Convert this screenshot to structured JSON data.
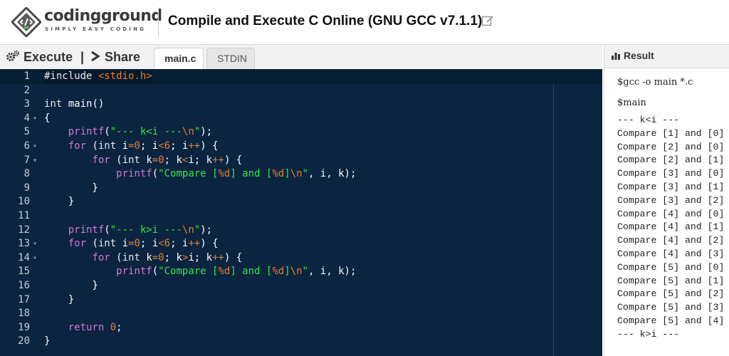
{
  "header": {
    "logo_word": "codingground",
    "logo_tagline": "SIMPLY EASY CODING",
    "title": "Compile and Execute C Online (GNU GCC v7.1.1)"
  },
  "toolbar": {
    "execute_label": "Execute",
    "separator": "|",
    "share_label": "Share",
    "tabs": [
      {
        "label": "main.c",
        "active": true
      },
      {
        "label": "STDIN",
        "active": false
      }
    ]
  },
  "result": {
    "title": "Result",
    "commands": [
      "$gcc -o main *.c",
      "$main"
    ],
    "output": [
      "--- k<i ---",
      "Compare [1] and [0]",
      "Compare [2] and [0]",
      "Compare [2] and [1]",
      "Compare [3] and [0]",
      "Compare [3] and [1]",
      "Compare [3] and [2]",
      "Compare [4] and [0]",
      "Compare [4] and [1]",
      "Compare [4] and [2]",
      "Compare [4] and [3]",
      "Compare [5] and [0]",
      "Compare [5] and [1]",
      "Compare [5] and [2]",
      "Compare [5] and [3]",
      "Compare [5] and [4]",
      "--- k>i ---"
    ]
  },
  "editor": {
    "language": "c",
    "active_line": 1,
    "fold_lines": [
      4,
      6,
      7,
      13,
      14
    ],
    "lines": [
      "#include <stdio.h>",
      "",
      "int main()",
      "{",
      "    printf(\"--- k<i ---\\n\");",
      "    for (int i=0; i<6; i++) {",
      "        for (int k=0; k<i; k++) {",
      "            printf(\"Compare [%d] and [%d]\\n\", i, k);",
      "        }",
      "    }",
      "",
      "    printf(\"--- k>i ---\\n\");",
      "    for (int i=0; i<6; i++) {",
      "        for (int k=0; k>i; k++) {",
      "            printf(\"Compare [%d] and [%d]\\n\", i, k);",
      "        }",
      "    }",
      "",
      "    return 0;",
      "}"
    ]
  },
  "colors": {
    "editor_bg": "#0b2440",
    "keyword": "#d47ad1",
    "string": "#2ee84a",
    "number": "#e87f2f"
  }
}
